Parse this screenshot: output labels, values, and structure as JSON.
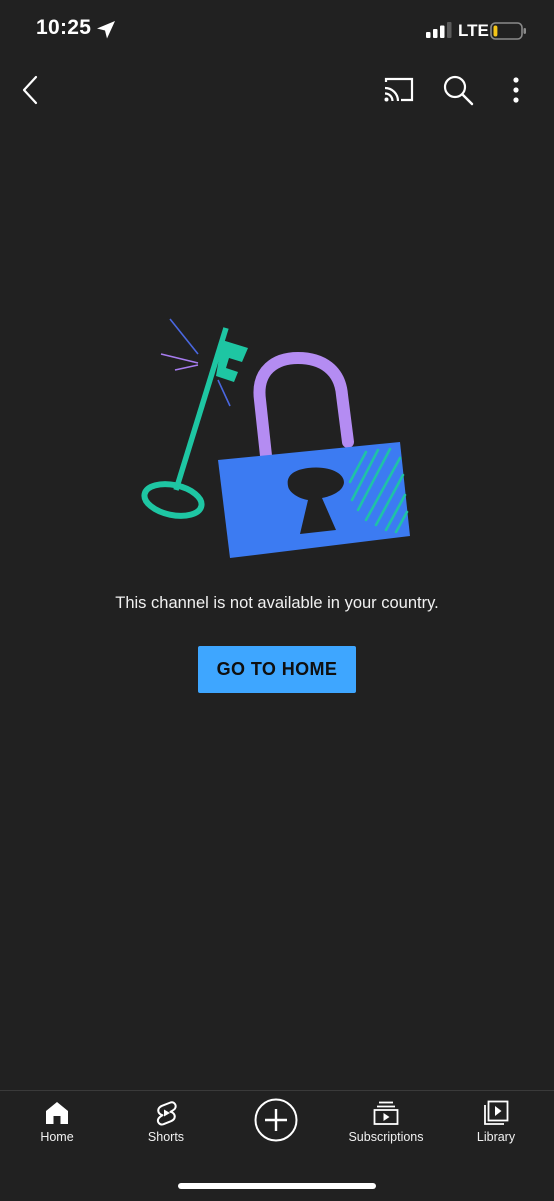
{
  "status_bar": {
    "time": "10:25",
    "network": "LTE",
    "location_icon": "location-arrow-icon",
    "battery_level": 0.15
  },
  "top_bar": {
    "icons": [
      "back-chevron-icon",
      "cast-icon",
      "search-icon",
      "more-vertical-icon"
    ]
  },
  "illustration": {
    "icon": "key-and-padlock-illustration",
    "colors": {
      "key": "#1ec6a3",
      "shackle": "#b48cf2",
      "lock_body": "#3c7bf2",
      "keyhole": "#212121",
      "sparks_blue": "#4a67e0",
      "sparks_purple": "#a77cf0"
    }
  },
  "message": "This channel is not available in your country.",
  "actions": {
    "go_home_label": "GO TO HOME",
    "button_color": "#3ea6ff"
  },
  "bottom_nav": {
    "items": [
      {
        "label": "Home",
        "icon": "home-icon"
      },
      {
        "label": "Shorts",
        "icon": "shorts-icon"
      },
      {
        "label": "",
        "icon": "create-plus-icon"
      },
      {
        "label": "Subscriptions",
        "icon": "subscriptions-icon"
      },
      {
        "label": "Library",
        "icon": "library-icon"
      }
    ]
  },
  "theme": {
    "background": "#212121",
    "text": "#ffffff"
  }
}
